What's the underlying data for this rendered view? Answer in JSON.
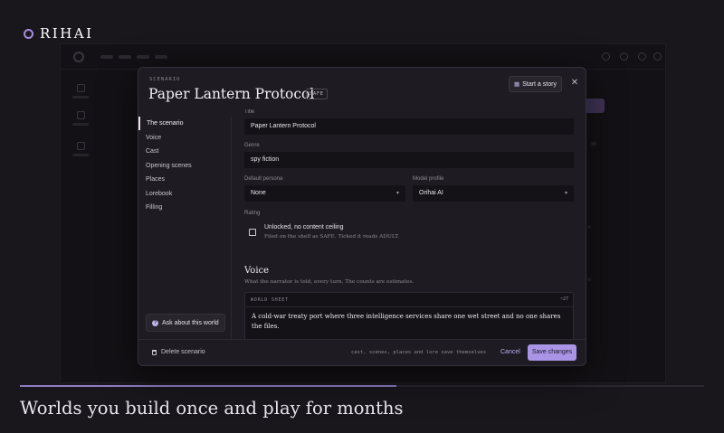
{
  "brand": {
    "name": "RIHAI",
    "accent": "#a48cdc"
  },
  "tagline": "Worlds you build once and play for months",
  "progress": {
    "fraction": 0.55
  },
  "modal": {
    "eyebrow": "SCENARIO",
    "title": "Paper Lantern Protocol",
    "rating_badge": "SAFE",
    "start_story_label": "Start a story",
    "nav": [
      "The scenario",
      "Voice",
      "Cast",
      "Opening scenes",
      "Places",
      "Lorebook",
      "Filling"
    ],
    "active_nav": "The scenario",
    "ask_label": "Ask about this world",
    "form": {
      "title_label": "Title",
      "title_value": "Paper Lantern Protocol",
      "genre_label": "Genre",
      "genre_value": "spy fiction",
      "persona_label": "Default persona",
      "persona_value": "None",
      "model_label": "Model profile",
      "model_value": "Orihai AI",
      "rating_label": "Rating",
      "rating_checkbox_title": "Unlocked, no content ceiling",
      "rating_checkbox_sub": "Filed on the shelf as SAFE. Ticked it reads ADULT.",
      "voice_heading": "Voice",
      "voice_sub": "What the narrator is told, every turn. The counts are estimates.",
      "world_sheet_label": "WORLD SHEET",
      "world_sheet_count": "~27",
      "world_sheet_text": "A cold-war treaty port where three intelligence services share one wet street and no one shares the files."
    },
    "footer": {
      "delete_label": "Delete scenario",
      "note": "cast, scenes, places and lore save themselves",
      "cancel_label": "Cancel",
      "save_label": "Save changes"
    }
  },
  "colors": {
    "primary": "#a994e6",
    "link": "#b9aef0"
  },
  "icons": [
    "book-icon",
    "close-icon",
    "question-icon",
    "trash-icon",
    "chevron-down-icon"
  ]
}
